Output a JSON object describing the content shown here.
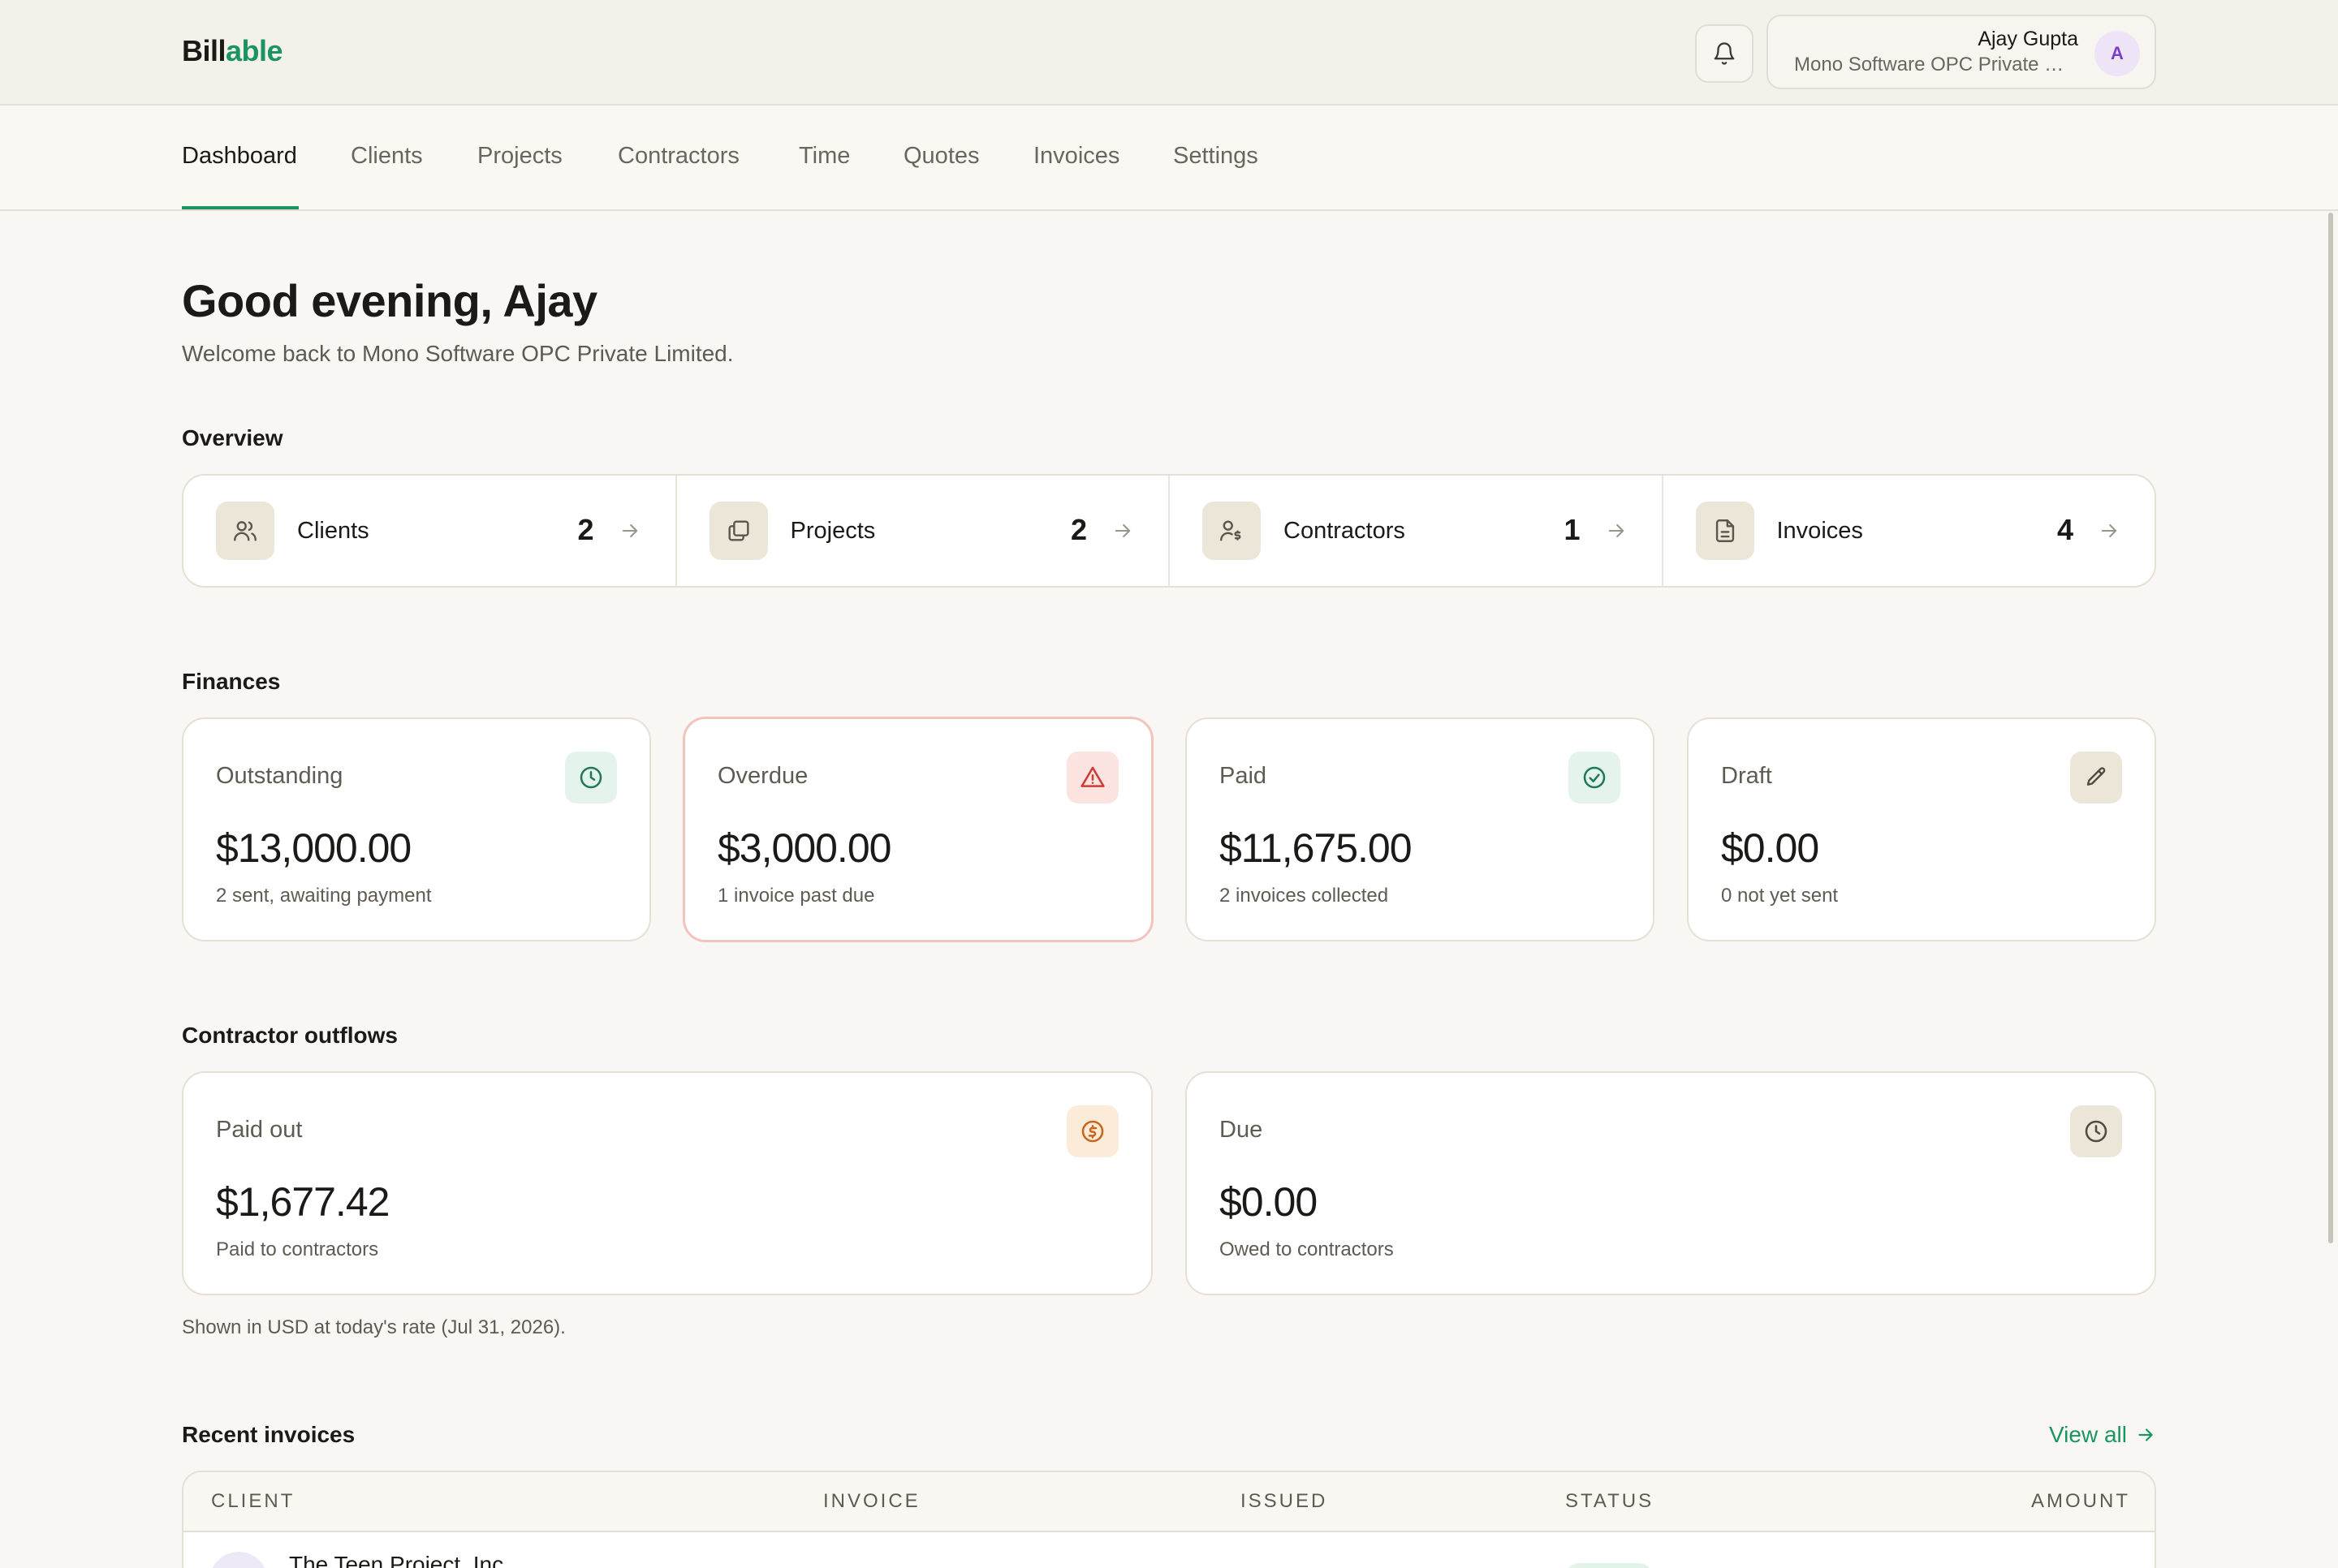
{
  "brand": {
    "part1": "Bill",
    "part2": "able"
  },
  "user": {
    "name": "Ajay Gupta",
    "org": "Mono Software OPC Private Limited",
    "avatar_initial": "A"
  },
  "nav": {
    "items": [
      "Dashboard",
      "Clients",
      "Projects",
      "Contractors",
      "Time",
      "Quotes",
      "Invoices",
      "Settings"
    ],
    "active": "Dashboard"
  },
  "greeting": {
    "title": "Good evening, Ajay",
    "subtitle": "Welcome back to Mono Software OPC Private Limited."
  },
  "overview": {
    "title": "Overview",
    "items": [
      {
        "label": "Clients",
        "count": "2",
        "icon": "users-icon"
      },
      {
        "label": "Projects",
        "count": "2",
        "icon": "folders-icon"
      },
      {
        "label": "Contractors",
        "count": "1",
        "icon": "user-dollar-icon"
      },
      {
        "label": "Invoices",
        "count": "4",
        "icon": "document-icon"
      }
    ]
  },
  "finances": {
    "title": "Finances",
    "cards": [
      {
        "label": "Outstanding",
        "value": "$13,000.00",
        "sub": "2 sent, awaiting payment",
        "icon": "clock-icon"
      },
      {
        "label": "Overdue",
        "value": "$3,000.00",
        "sub": "1 invoice past due",
        "icon": "warning-icon"
      },
      {
        "label": "Paid",
        "value": "$11,675.00",
        "sub": "2 invoices collected",
        "icon": "check-circle-icon"
      },
      {
        "label": "Draft",
        "value": "$0.00",
        "sub": "0 not yet sent",
        "icon": "pencil-icon"
      }
    ]
  },
  "outflows": {
    "title": "Contractor outflows",
    "cards": [
      {
        "label": "Paid out",
        "value": "$1,677.42",
        "sub": "Paid to contractors",
        "icon": "dollar-circle-icon"
      },
      {
        "label": "Due",
        "value": "$0.00",
        "sub": "Owed to contractors",
        "icon": "clock-icon"
      }
    ],
    "note": "Shown in USD at today's rate (Jul 31, 2026)."
  },
  "recent": {
    "title": "Recent invoices",
    "view_all": "View all",
    "columns": [
      "CLIENT",
      "INVOICE",
      "ISSUED",
      "STATUS",
      "AMOUNT"
    ],
    "rows": [
      {
        "client": "The Teen Project, Inc"
      }
    ]
  },
  "colors": {
    "accent": "#1a9562",
    "background": "#f8f7f3",
    "header": "#f4f1ea",
    "overdue_border": "#f2c4bd",
    "overdue_icon": "#d03a32",
    "paid_out_icon": "#c8651a"
  }
}
